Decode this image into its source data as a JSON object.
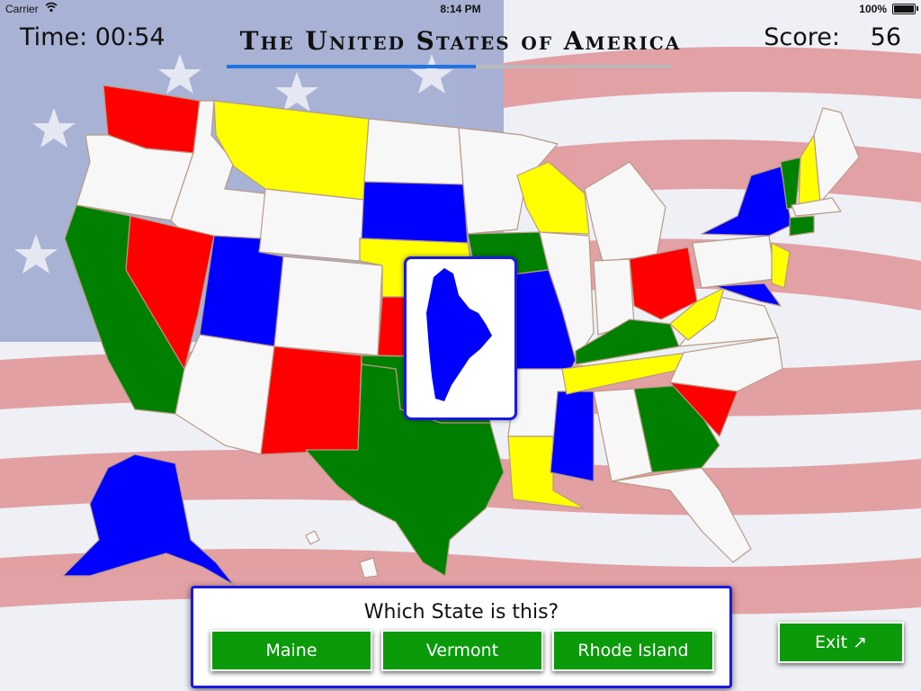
{
  "status_bar": {
    "carrier": "Carrier",
    "time": "8:14 PM",
    "battery": "100%"
  },
  "header": {
    "timer": "Time: 00:54",
    "title": "The United States of America",
    "score_label": "Score:",
    "score_value": "56",
    "progress_fraction": 0.56
  },
  "map": {
    "highlighted_state_card": "Maine",
    "colors": {
      "red": "#ff0000",
      "yellow": "#ffff00",
      "blue": "#0000ff",
      "green": "#008000",
      "unfilled": "#f7f7f7",
      "border": "#b89a86"
    }
  },
  "question": {
    "prompt": "Which State is this?",
    "answers": [
      "Maine",
      "Vermont",
      "Rhode Island"
    ]
  },
  "exit_label": "Exit",
  "exit_icon": "arrow-up-right-icon",
  "theme": {
    "button_green": "#0a9a0a",
    "panel_border": "#1a1ae0",
    "progress_blue": "#1f74e6"
  }
}
